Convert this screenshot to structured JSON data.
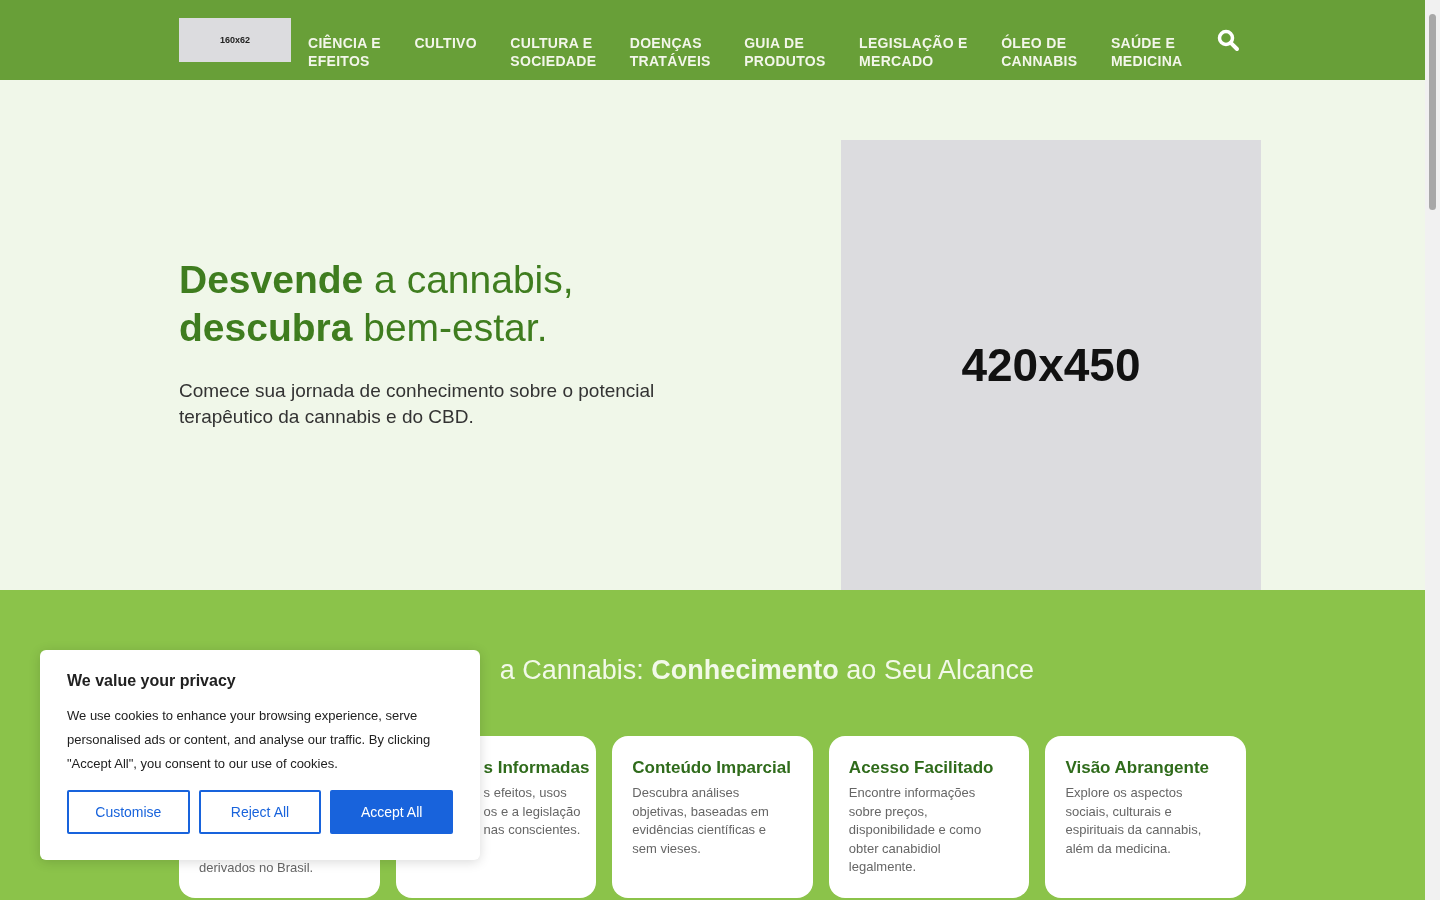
{
  "header": {
    "logo": "160x62",
    "nav": [
      {
        "lines": [
          "CIÊNCIA E",
          "EFEITOS"
        ]
      },
      {
        "lines": [
          "CULTIVO"
        ]
      },
      {
        "lines": [
          "CULTURA E",
          "SOCIEDADE"
        ]
      },
      {
        "lines": [
          "DOENÇAS",
          "TRATÁVEIS"
        ]
      },
      {
        "lines": [
          "GUIA DE",
          "PRODUTOS"
        ]
      },
      {
        "lines": [
          "LEGISLAÇÃO E",
          "MERCADO"
        ]
      },
      {
        "lines": [
          "ÓLEO DE",
          "CANNABIS"
        ]
      },
      {
        "lines": [
          "SAÚDE E",
          "MEDICINA"
        ]
      }
    ]
  },
  "hero": {
    "heading_lines": [
      "**Desvende** a cannabis,",
      "**descubra** bem-estar."
    ],
    "text": "Comece sua jornada de conhecimento sobre o potencial terapêutico da cannabis e do CBD.",
    "image_label": "420x450"
  },
  "features": {
    "heading": "a Cannabis: **Conhecimento** ao Seu Alcance",
    "cards": [
      {
        "kind": "bottom",
        "lines": [
          "derivados no Brasil."
        ]
      },
      {
        "kind": "partial",
        "title": "s Informadas",
        "lines": [
          "s efeitos, usos",
          "os e a legislação",
          "nas conscientes."
        ]
      },
      {
        "kind": "full",
        "title": "Conteúdo Imparcial",
        "lines": [
          "Descubra análises objetivas, baseadas em evidências científicas e sem vieses."
        ]
      },
      {
        "kind": "full",
        "title": "Acesso Facilitado",
        "lines": [
          "Encontre informações sobre preços, disponibilidade e como obter canabidiol legalmente."
        ]
      },
      {
        "kind": "full",
        "title": "Visão Abrangente",
        "lines": [
          "Explore os aspectos sociais, culturais e espirituais da cannabis, além da medicina."
        ]
      }
    ]
  },
  "cookie_banner": {
    "title": "We value your privacy",
    "text": "We use cookies to enhance your browsing experience, serve personalised ads or content, and analyse our traffic. By clicking \"Accept All\", you consent to our use of cookies.",
    "buttons": [
      {
        "label": "Customise",
        "kind": "outline"
      },
      {
        "label": "Reject All",
        "kind": "outline"
      },
      {
        "label": "Accept All",
        "kind": "primary"
      }
    ]
  }
}
